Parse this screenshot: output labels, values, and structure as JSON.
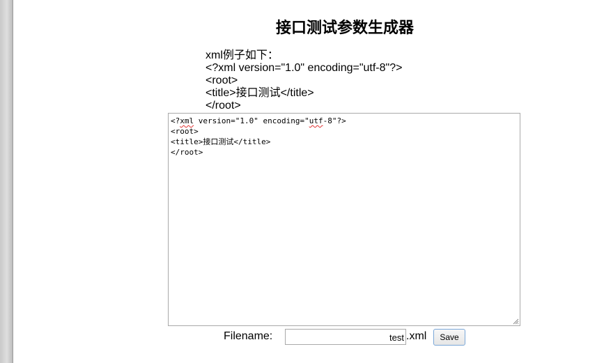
{
  "page": {
    "title": "接口测试参数生成器"
  },
  "example": {
    "intro": "xml例子如下：",
    "lines": [
      "<?xml version=\"1.0\" encoding=\"utf-8\"?>",
      "<root>",
      "<title>接口测试</title>",
      "</root>"
    ]
  },
  "editor": {
    "line1_prefix": "<?",
    "line1_xml": "xml",
    "line1_mid": " version=\"1.0\" encoding=\"",
    "line1_utf": "utf",
    "line1_suffix": "-8\"?>",
    "line2": "<root>",
    "line3": "<title>接口测试</title>",
    "line4": "</root>"
  },
  "save": {
    "filename_label": "Filename:",
    "filename_value": "test",
    "extension": ".xml",
    "button_label": "Save"
  }
}
